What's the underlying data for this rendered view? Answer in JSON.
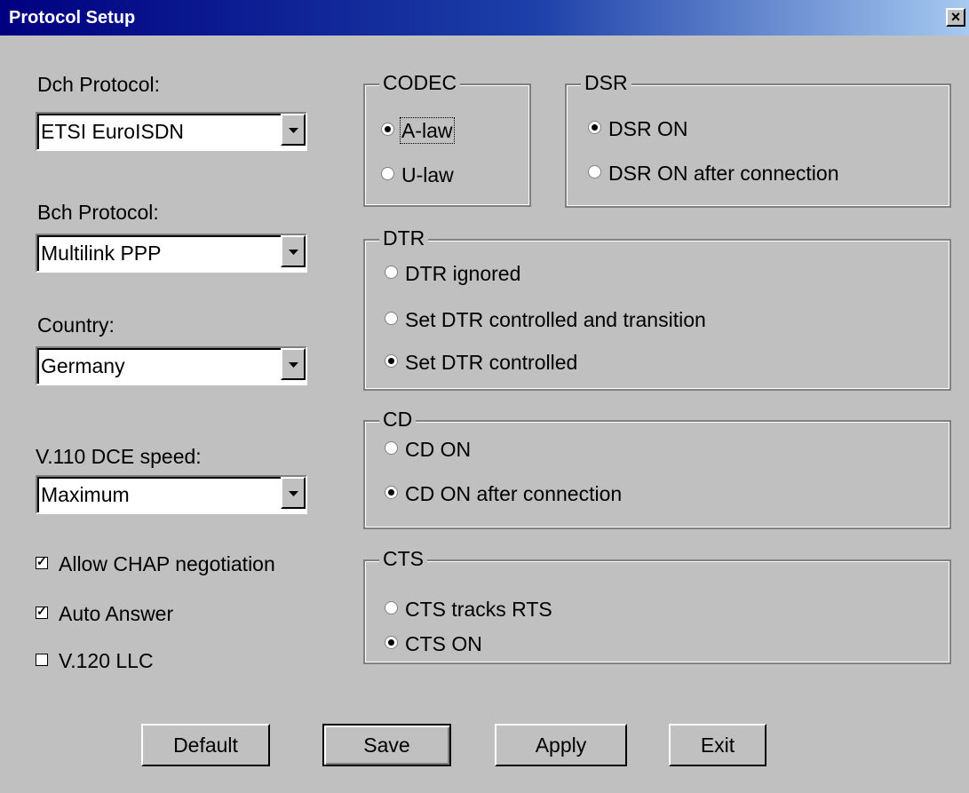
{
  "window": {
    "title": "Protocol Setup",
    "close_label": "×"
  },
  "left": {
    "dch": {
      "label": "Dch Protocol:",
      "value": "ETSI EuroISDN"
    },
    "bch": {
      "label": "Bch Protocol:",
      "value": "Multilink PPP"
    },
    "country": {
      "label": "Country:",
      "value": "Germany"
    },
    "v110": {
      "label": "V.110 DCE speed:",
      "value": "Maximum"
    },
    "checkboxes": [
      {
        "label": "Allow CHAP negotiation",
        "checked": true
      },
      {
        "label": "Auto Answer",
        "checked": true
      },
      {
        "label": "V.120 LLC",
        "checked": false
      }
    ]
  },
  "codec": {
    "title": "CODEC",
    "options": [
      {
        "label": "A-law",
        "selected": true
      },
      {
        "label": "U-law",
        "selected": false
      }
    ]
  },
  "dsr": {
    "title": "DSR",
    "options": [
      {
        "label": "DSR ON",
        "selected": true
      },
      {
        "label": "DSR ON after connection",
        "selected": false
      }
    ]
  },
  "dtr": {
    "title": "DTR",
    "options": [
      {
        "label": "DTR ignored",
        "selected": false
      },
      {
        "label": "Set DTR controlled and transition",
        "selected": false
      },
      {
        "label": "Set DTR controlled",
        "selected": true
      }
    ]
  },
  "cd": {
    "title": "CD",
    "options": [
      {
        "label": "CD ON",
        "selected": false
      },
      {
        "label": "CD ON after connection",
        "selected": true
      }
    ]
  },
  "cts": {
    "title": "CTS",
    "options": [
      {
        "label": "CTS tracks RTS",
        "selected": false
      },
      {
        "label": "CTS ON",
        "selected": true
      }
    ]
  },
  "buttons": {
    "default": "Default",
    "save": "Save",
    "apply": "Apply",
    "exit": "Exit"
  }
}
